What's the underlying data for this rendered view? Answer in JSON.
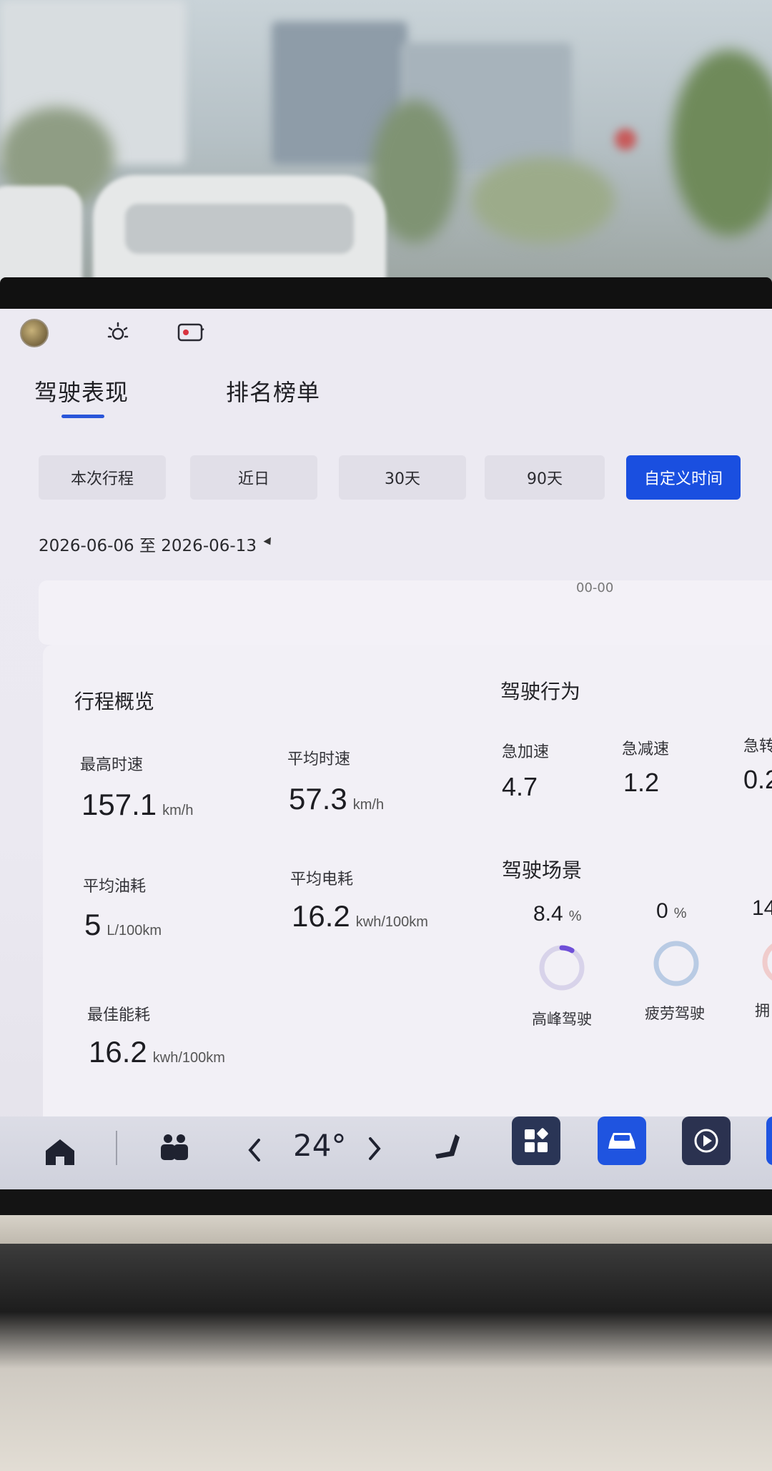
{
  "tabs": {
    "performance": "驾驶表现",
    "ranking": "排名榜单"
  },
  "periods": [
    {
      "label": "本次行程",
      "active": false
    },
    {
      "label": "近日",
      "active": false
    },
    {
      "label": "30天",
      "active": false
    },
    {
      "label": "90天",
      "active": false
    },
    {
      "label": "自定义时间",
      "active": true
    }
  ],
  "date_range": "2026-06-06 至 2026-06-13",
  "upper_card_cut_text": "00-00",
  "trip_overview": {
    "title": "行程概览",
    "max_speed": {
      "label": "最高时速",
      "value": "157.1",
      "unit": "km/h"
    },
    "avg_speed": {
      "label": "平均时速",
      "value": "57.3",
      "unit": "km/h"
    },
    "avg_fuel": {
      "label": "平均油耗",
      "value": "5",
      "unit": "L/100km"
    },
    "avg_electric": {
      "label": "平均电耗",
      "value": "16.2",
      "unit": "kwh/100km"
    },
    "best_energy": {
      "label": "最佳能耗",
      "value": "16.2",
      "unit": "kwh/100km"
    }
  },
  "driving_behavior": {
    "title": "驾驶行为",
    "items": [
      {
        "label": "急加速",
        "value": "4.7"
      },
      {
        "label": "急减速",
        "value": "1.2"
      },
      {
        "label": "急转",
        "value": "0.2"
      }
    ]
  },
  "driving_scene": {
    "title": "驾驶场景",
    "items": [
      {
        "label": "高峰驾驶",
        "value": "8.4",
        "unit": "%",
        "percent": 8.4,
        "color": "#6f4fd8"
      },
      {
        "label": "疲劳驾驶",
        "value": "0",
        "unit": "%",
        "percent": 0,
        "color": "#8fb0d8"
      },
      {
        "label": "拥",
        "value": "14",
        "unit": "",
        "percent": 14,
        "color": "#e59a9a"
      }
    ]
  },
  "dock": {
    "temperature": "24°"
  },
  "colors": {
    "accent": "#1a4fe0",
    "screen_bg": "#ebe9f1"
  }
}
